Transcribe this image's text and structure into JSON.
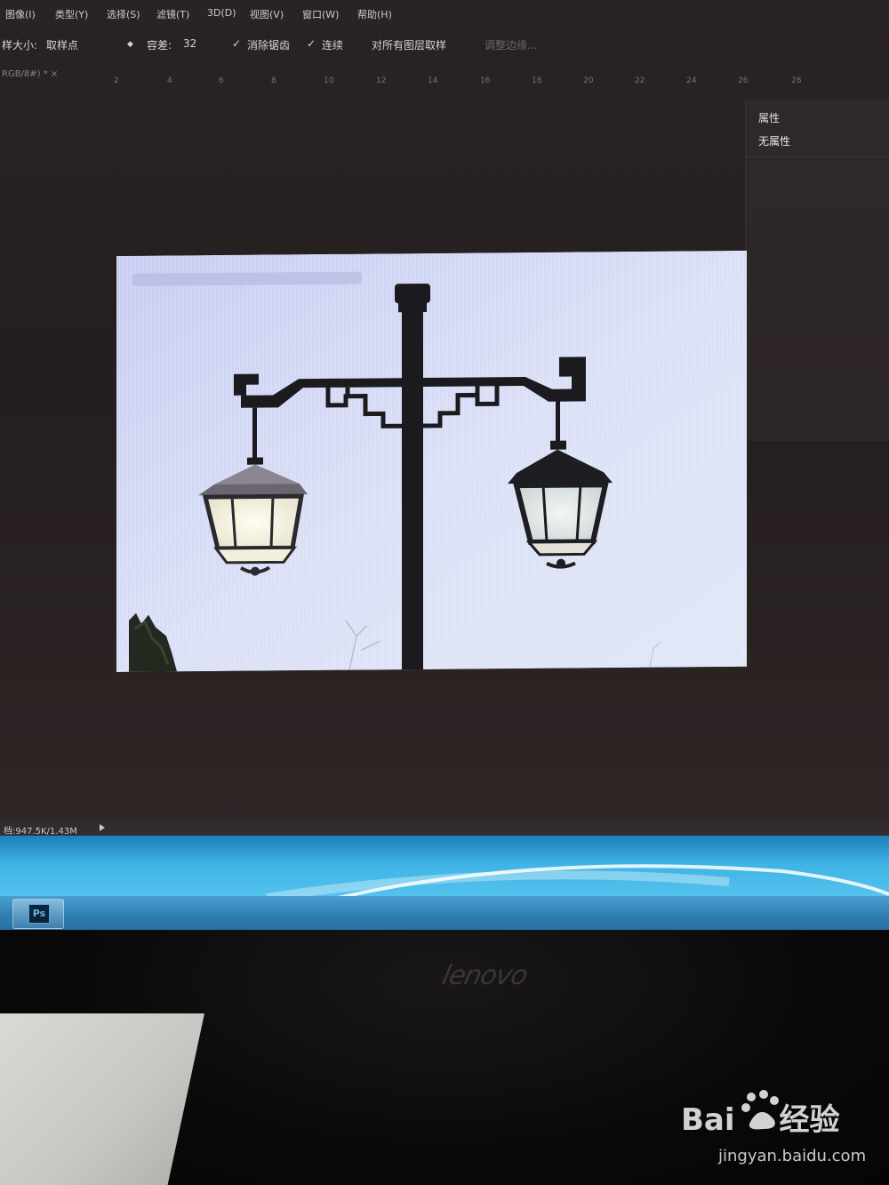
{
  "menu": {
    "items": [
      "图像(I)",
      "类型(Y)",
      "选择(S)",
      "滤镜(T)",
      "3D(D)",
      "视图(V)",
      "窗口(W)",
      "帮助(H)"
    ]
  },
  "options": {
    "sample_size_label": "样大小:",
    "sample_size_value": "取样点",
    "tolerance_label": "容差:",
    "tolerance_value": "32",
    "antialias_label": "消除锯齿",
    "contiguous_label": "连续",
    "all_layers_label": "对所有图层取样",
    "refine_edge_label": "调整边缘..."
  },
  "document": {
    "tab_label": "RGB/8#) * ×"
  },
  "ruler": {
    "ticks": [
      "2",
      "4",
      "6",
      "8",
      "10",
      "12",
      "14",
      "16",
      "18",
      "20",
      "22",
      "24",
      "26",
      "28"
    ]
  },
  "properties_panel": {
    "title": "属性",
    "value": "无属性"
  },
  "status_bar": {
    "doc_size": "档:947.5K/1.43M"
  },
  "taskbar": {
    "app_icon_label": "Ps"
  },
  "monitor": {
    "brand": "lenovo"
  },
  "watermark": {
    "logo_text_1": "Bai",
    "logo_text_2": "经验",
    "url": "jingyan.baidu.com"
  }
}
